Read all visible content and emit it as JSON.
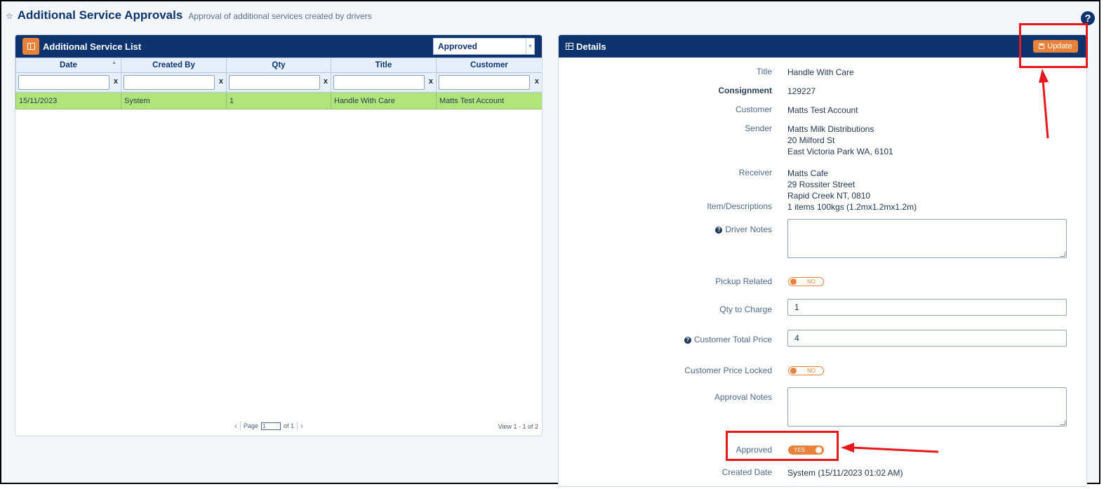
{
  "header": {
    "title": "Additional Service Approvals",
    "subtitle": "Approval of additional services created by drivers"
  },
  "list_panel": {
    "title": "Additional Service List",
    "status_filter": "Approved",
    "columns": [
      "Date",
      "Created By",
      "Qty",
      "Title",
      "Customer"
    ],
    "filter_clear": "x",
    "rows": [
      [
        "15/11/2023",
        "System",
        "1",
        "Handle With Care",
        "Matts Test Account"
      ]
    ],
    "pager": {
      "page_label": "Page",
      "page_value": "1",
      "of_label": "of 1",
      "view_text": "View 1 - 1 of 2"
    }
  },
  "details": {
    "title": "Details",
    "update_label": "Update",
    "fields": {
      "title_label": "Title",
      "title_value": "Handle With Care",
      "consignment_label": "Consignment",
      "consignment_value": "129227",
      "customer_label": "Customer",
      "customer_value": "Matts Test Account",
      "sender_label": "Sender",
      "sender_lines": [
        "Matts Milk Distributions",
        "20 Milford St",
        "East Victoria Park WA, 6101"
      ],
      "receiver_label": "Receiver",
      "receiver_lines": [
        "Matts Cafe",
        "29 Rossiter Street",
        "Rapid Creek NT, 0810"
      ],
      "item_label": "Item/Descriptions",
      "item_value": "1 items 100kgs (1.2mx1.2mx1.2m)",
      "driver_notes_label": "Driver Notes",
      "pickup_related_label": "Pickup Related",
      "pickup_related_value": "NO",
      "qty_label": "Qty to Charge",
      "qty_value": "1",
      "total_price_label": "Customer Total Price",
      "total_price_value": "4",
      "price_locked_label": "Customer Price Locked",
      "price_locked_value": "NO",
      "approval_notes_label": "Approval Notes",
      "approved_label": "Approved",
      "approved_value": "YES",
      "created_date_label": "Created Date",
      "created_date_value": "System (15/11/2023 01:02 AM)"
    }
  },
  "colors": {
    "navy": "#0e3470",
    "accent": "#e8823b",
    "row_selected": "#b0e57c",
    "annotation": "#e8171b"
  }
}
